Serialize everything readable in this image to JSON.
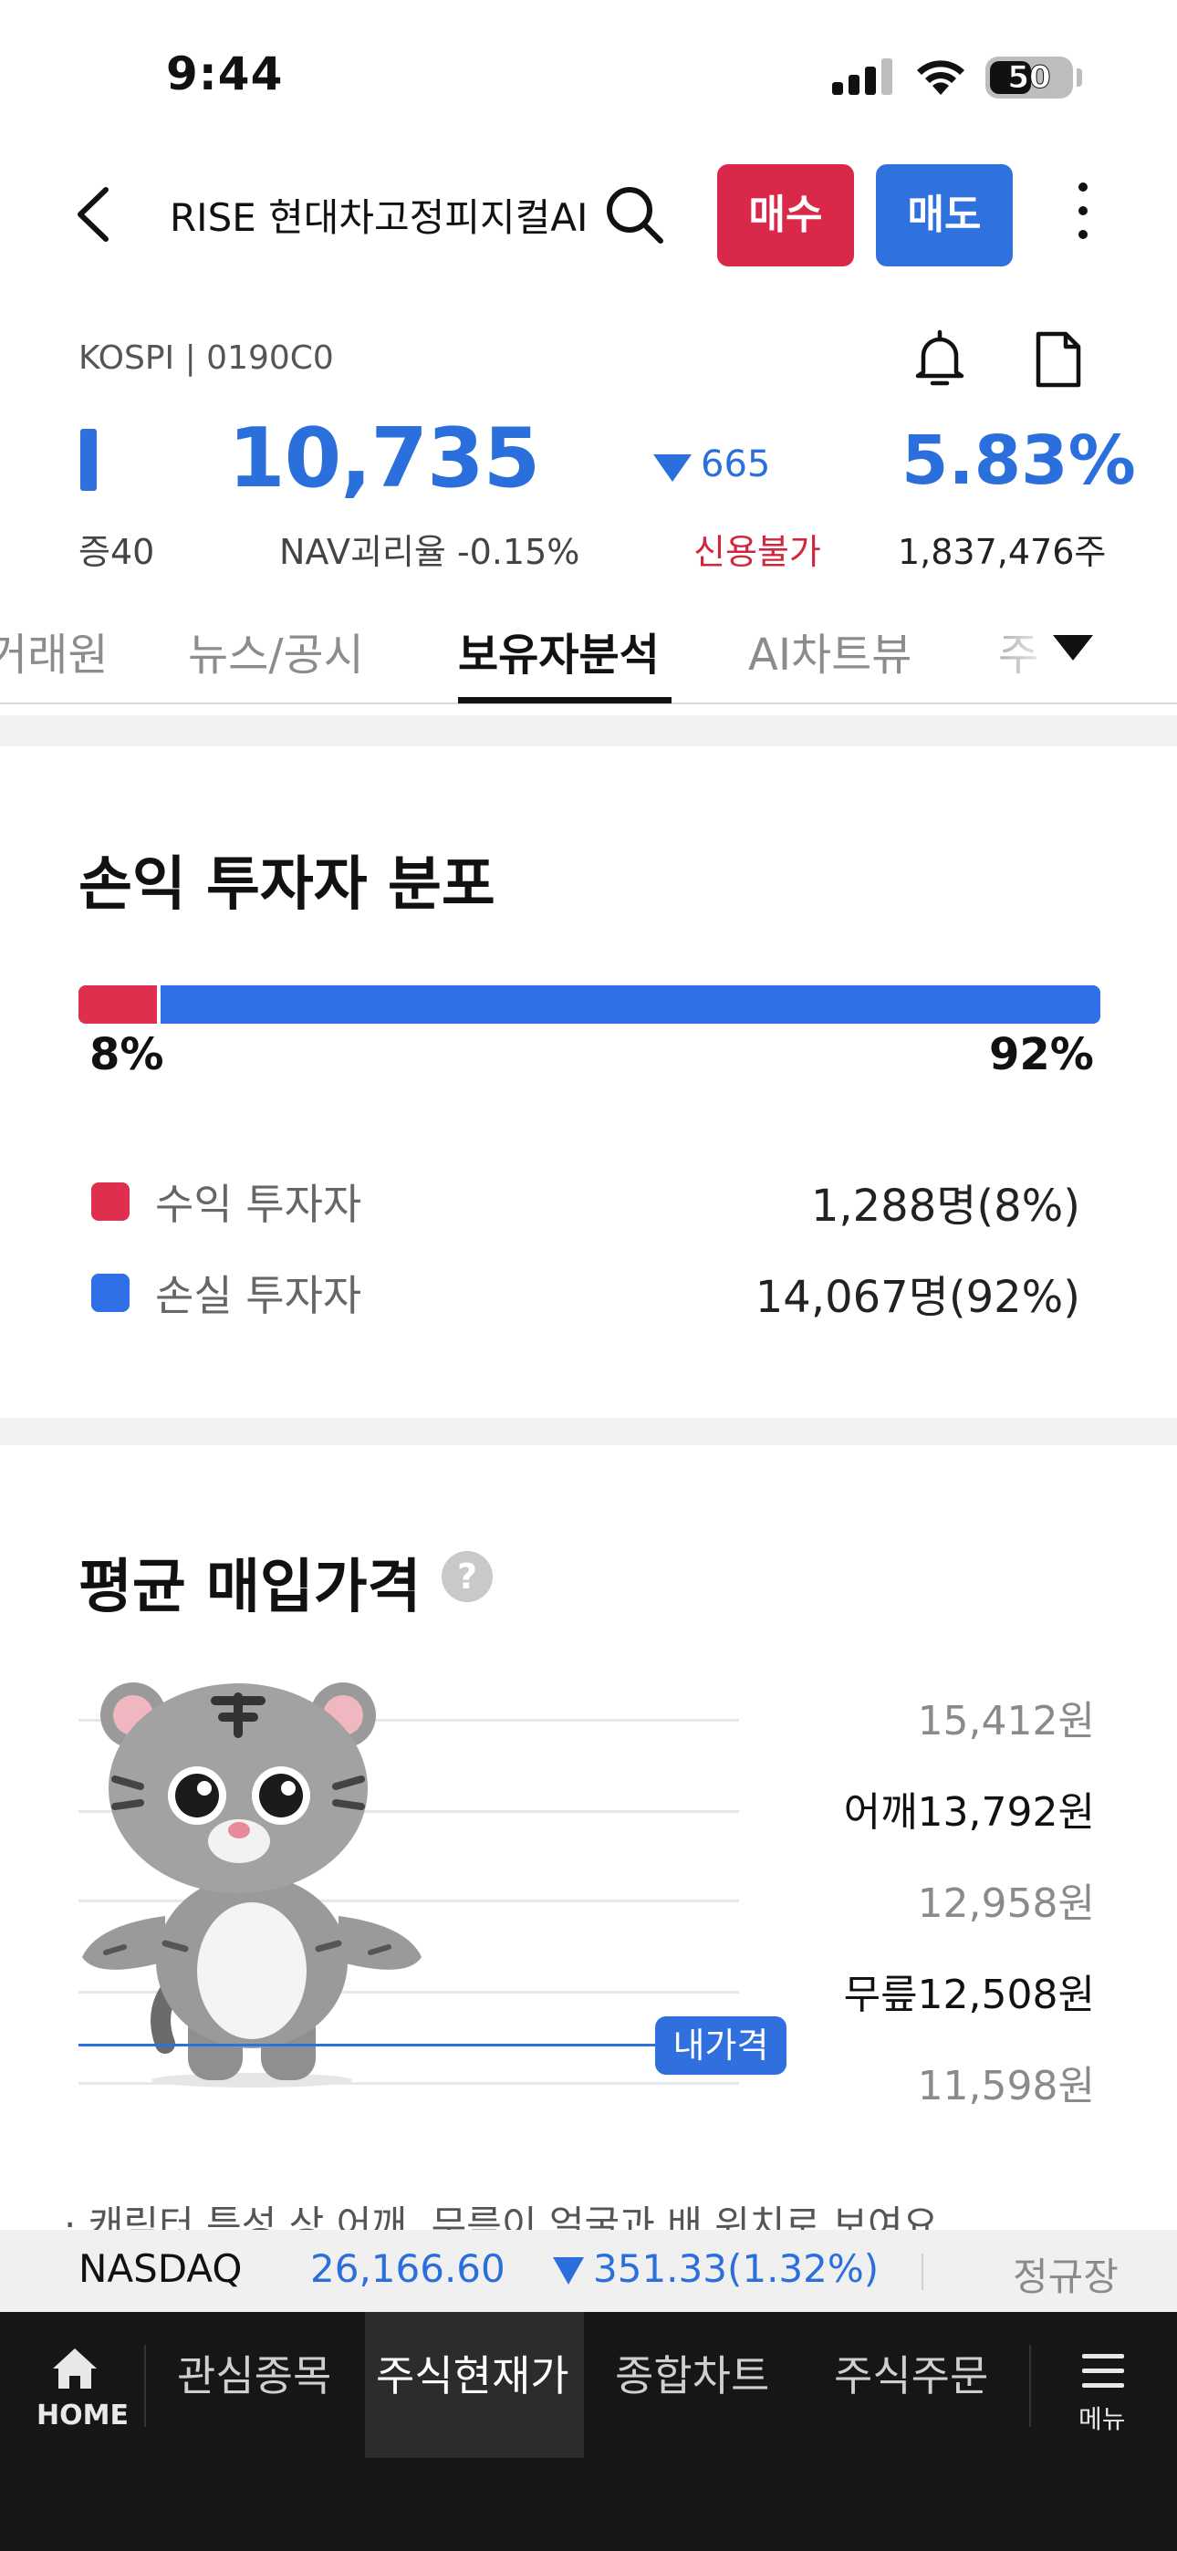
{
  "status": {
    "time": "9:44",
    "battery": "50"
  },
  "header": {
    "title": "RISE 현대차고정피지컬AI",
    "buy_label": "매수",
    "sell_label": "매도"
  },
  "quote": {
    "market_code": "KOSPI | 0190C0",
    "price": "10,735",
    "change": "665",
    "change_rate": "5.83%",
    "margin": "증40",
    "nav_gap": "NAV괴리율 -0.15%",
    "credit": "신용불가",
    "volume": "1,837,476주"
  },
  "tabs": [
    {
      "label": "거래원"
    },
    {
      "label": "뉴스/공시"
    },
    {
      "label": "보유자분석",
      "active": true
    },
    {
      "label": "AI차트뷰"
    },
    {
      "label": "주"
    }
  ],
  "distribution": {
    "title": "손익 투자자 분포",
    "profit_pct": "8%",
    "loss_pct": "92%",
    "profit_share": 0.08,
    "profit_label": "수익 투자자",
    "profit_value": "1,288명(8%)",
    "loss_label": "손실 투자자",
    "loss_value": "14,067명(92%)",
    "profit_color": "#df2f4f",
    "loss_color": "#2f6fe8"
  },
  "avg_price": {
    "title": "평균 매입가격",
    "help": "?",
    "my_price_tag": "내가격",
    "levels": [
      {
        "label": "15,412원"
      },
      {
        "label": "어깨13,792원"
      },
      {
        "label": "12,958원"
      },
      {
        "label": "무릎12,508원"
      },
      {
        "label": "11,598원"
      }
    ],
    "note": "· 캐릭터 특성 상 어깨, 무릎이 얼굴과 배 위치로 보여요"
  },
  "ticker": {
    "name": "NASDAQ",
    "value": "26,166.60",
    "change": "351.33(1.32%)",
    "session": "정규장"
  },
  "bottom_nav": {
    "home": "HOME",
    "watchlist": "관심종목",
    "current_price": "주식현재가",
    "chart": "종합차트",
    "order": "주식주문",
    "menu": "메뉴"
  }
}
